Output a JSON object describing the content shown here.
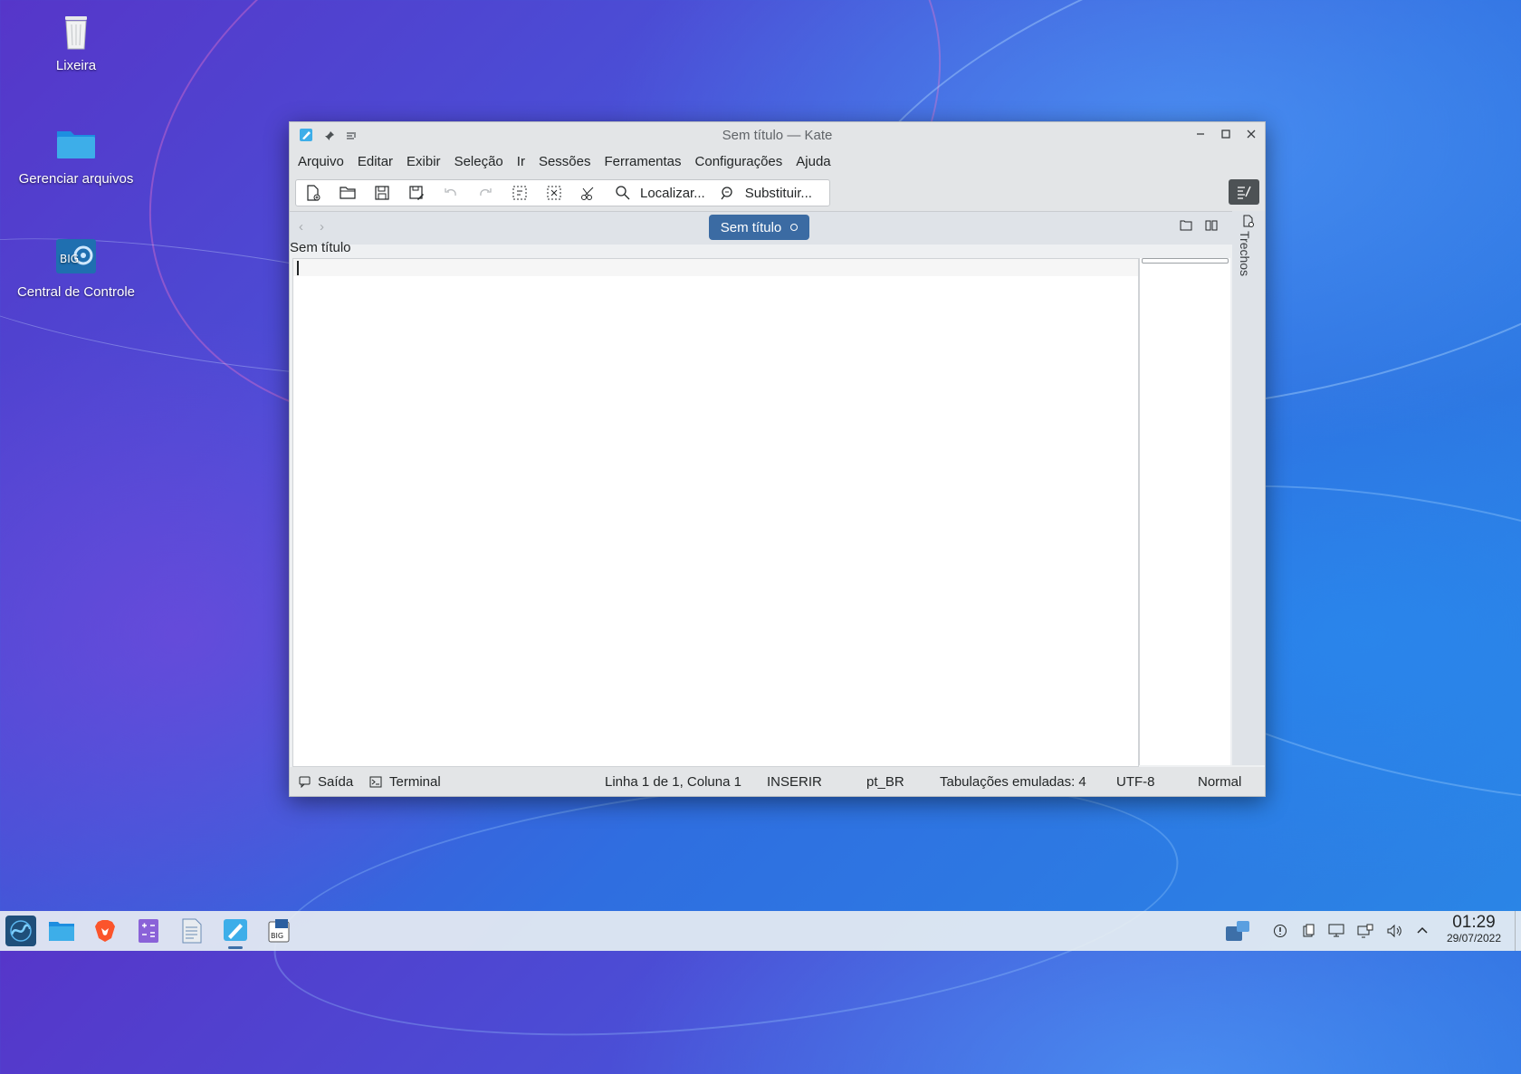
{
  "desktop": {
    "icons": [
      {
        "label": "Lixeira"
      },
      {
        "label": "Gerenciar arquivos"
      },
      {
        "label": "Central de Controle"
      }
    ]
  },
  "window": {
    "title": "Sem título — Kate",
    "menu": [
      "Arquivo",
      "Editar",
      "Exibir",
      "Seleção",
      "Ir",
      "Sessões",
      "Ferramentas",
      "Configurações",
      "Ajuda"
    ],
    "toolbar": {
      "find_label": "Localizar...",
      "replace_label": "Substituir..."
    },
    "tab": {
      "label": "Sem título"
    },
    "breadcrumb": "Sem título",
    "side_rail_label": "Trechos",
    "status": {
      "output": "Saída",
      "terminal": "Terminal",
      "position": "Linha 1 de 1, Coluna 1",
      "mode": "INSERIR",
      "language": "pt_BR",
      "tabs": "Tabulações emuladas: 4",
      "encoding": "UTF-8",
      "highlight": "Normal"
    }
  },
  "taskbar": {
    "time": "01:29",
    "date": "29/07/2022"
  },
  "colors": {
    "tab_active": "#3b6ba3",
    "accent": "#3daee9"
  }
}
